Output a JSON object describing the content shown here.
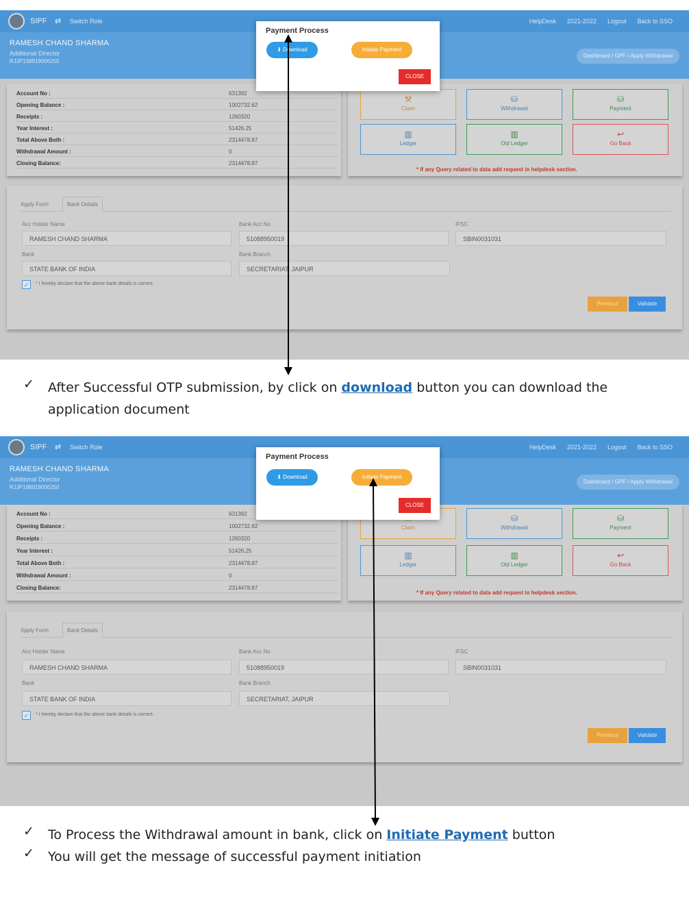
{
  "app": {
    "brand": "SIPF",
    "switch_role": "Switch Role",
    "helpdesk": "HelpDesk",
    "year": "2021-2022",
    "logout": "Logout",
    "back_to_sso": "Back to SSO"
  },
  "user": {
    "name": "RAMESH CHAND SHARMA",
    "designation": "Additional Director",
    "id": "RJJP198919006250"
  },
  "breadcrumb": {
    "home": "Dashboard",
    "gpf": "GPF",
    "current": "Apply Withdrawal"
  },
  "account": [
    {
      "label": "Account No :",
      "value": "631392"
    },
    {
      "label": "Opening Balance :",
      "value": "1002732.62"
    },
    {
      "label": "Receipts :",
      "value": "1260320"
    },
    {
      "label": "Year Interest :",
      "value": "51426.25"
    },
    {
      "label": "Total Above Both :",
      "value": "2314478.87"
    },
    {
      "label": "Withdrawal Amount :",
      "value": "0"
    },
    {
      "label": "Closing Balance:",
      "value": "2314478.87"
    }
  ],
  "actions": {
    "claim": "Claim",
    "withdrawal": "Withdrawal",
    "payment": "Payment",
    "ledger": "Ledger",
    "old_ledger": "Old Ledger",
    "go_back": "Go Back",
    "query_note": "* If any Query related to data add request in helpdesk section."
  },
  "form": {
    "tab_apply": "Apply Form",
    "tab_bank": "Bank Details",
    "acc_holder_label": "Acc Holder Name",
    "acc_holder_value": "RAMESH CHAND SHARMA",
    "bank_acc_label": "Bank Acc No",
    "bank_acc_value": "51088950019",
    "ifsc_label": "IFSC",
    "ifsc_value": "SBIN0031031",
    "bank_label": "Bank",
    "bank_value": "STATE BANK OF INDIA",
    "branch_label": "Bank Branch",
    "branch_value": "SECRETARIAT, JAIPUR",
    "declaration": "* I hereby declare that the above bank details is correct.",
    "previous": "Previous",
    "validate": "Validate"
  },
  "modal": {
    "title": "Payment Process",
    "download": "Download",
    "initiate": "Initiate Payment",
    "close": "CLOSE"
  },
  "captions": {
    "c1_pre": "After Successful OTP submission, by click on ",
    "c1_link": "download",
    "c1_post": " button you can download the application document",
    "c2_pre": "To Process the Withdrawal amount in bank, click on ",
    "c2_link": "Initiate Payment",
    "c2_post": " button",
    "c3": "You will get the message of successful payment initiation"
  },
  "colors": {
    "topbar": "#4a95d6",
    "download": "#2f9ae5",
    "initiate": "#f6ad38",
    "close": "#e62b2b",
    "link": "#1f6bb4"
  }
}
